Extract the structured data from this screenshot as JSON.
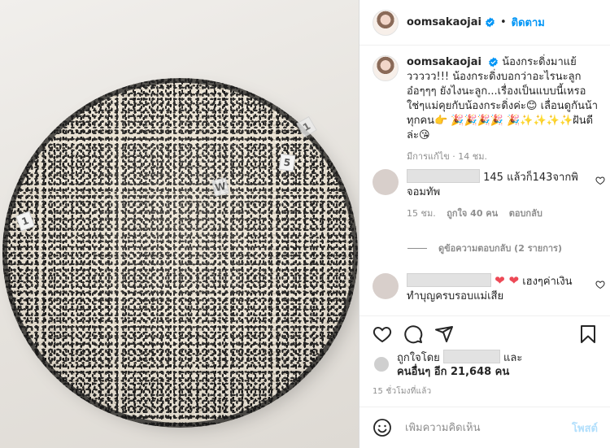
{
  "photo": {
    "tags": [
      "1",
      "5",
      "W",
      "1"
    ]
  },
  "header": {
    "username": "oomsakaojai",
    "separator": "•",
    "follow_label": "ติดตาม"
  },
  "caption": {
    "username": "oomsakaojai",
    "text": "น้องกระดิ่งมาแย้ววววว!!! น้องกระดิ่งบอกว่าอะไรนะลูก อ๋อๆๆๆ ยังไงนะลูก...เรื่องเป็นแบบนี้เหรอ ใช่ๆแม่คุยกับน้องกระดิ่งค่ะ😊 เลื่อนดูกันน้าทุกคน👉 🎉🎉🎉🎉 🎉✨✨✨✨ฝันดีล่ะ😘",
    "meta": "มีการแก้ไข · 14 ชม."
  },
  "comments": [
    {
      "text": "145 แล้วก็143จากพิจอมทัพ",
      "time": "15 ชม.",
      "likes": "ถูกใจ 40 คน",
      "reply": "ตอบกลับ"
    },
    {
      "hearts": "❤ ❤",
      "text": "เฮงๆค่าเงินทำบุญครบรอบแม่เสีย"
    }
  ],
  "view_replies": "ดูข้อความตอบกลับ (2 รายการ)",
  "likes": {
    "prefix": "ถูกใจโดย",
    "suffix": "และ",
    "others": "คนอื่นๆ อีก 21,648 คน"
  },
  "timestamp": "15 ชั่วโมงที่แล้ว",
  "add_comment": {
    "placeholder": "เพิ่มความคิดเห็น",
    "post_label": "โพสต์"
  },
  "colors": {
    "accent": "#0095f6",
    "heart": "#ed4956",
    "muted": "#8e8e8e",
    "post_disabled": "#b2dffc"
  }
}
